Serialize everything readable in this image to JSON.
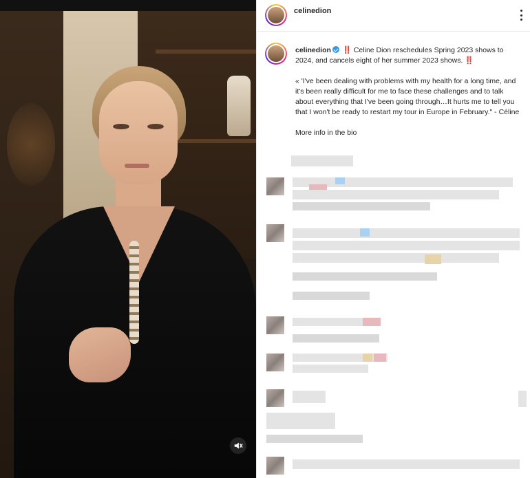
{
  "account": {
    "username": "celinedion",
    "verified": true
  },
  "post": {
    "caption_username": "celinedion",
    "caption_headline": "‼️ Celine Dion reschedules Spring 2023 shows to 2024, and cancels eight of her summer 2023 shows. ‼️",
    "caption_quote": "« 'I've been dealing with problems with my health for a long time, and it's been really difficult for me to face these challenges and to talk about everything that I've been going through…It hurts me to tell you that I won't be ready to restart my tour in Europe in February.\" - Céline",
    "caption_footer": "More info in the bio"
  },
  "media": {
    "type": "video",
    "muted": true
  },
  "icons": {
    "more": "more-options-icon",
    "mute": "speaker-muted-icon",
    "verified": "verified-badge-icon"
  },
  "colors": {
    "verified_blue": "#3897f0",
    "text": "#262626"
  }
}
